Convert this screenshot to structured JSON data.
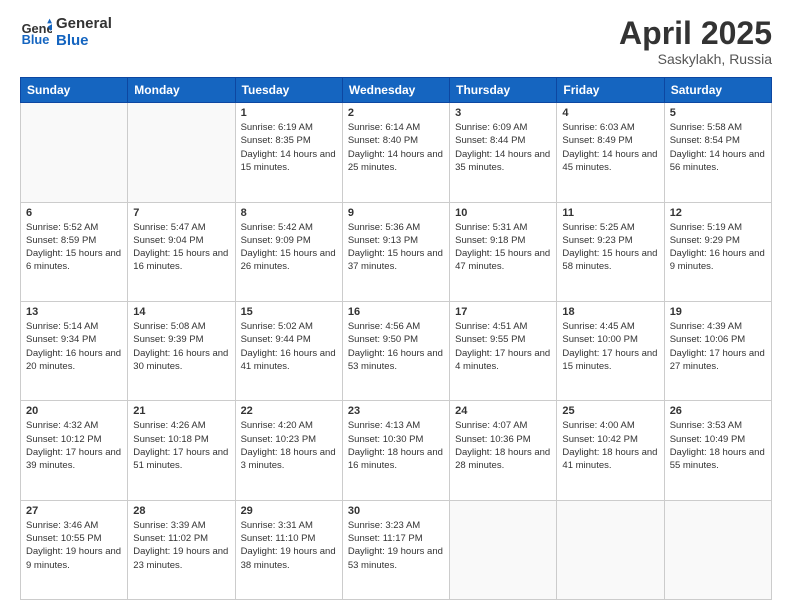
{
  "header": {
    "logo_line1": "General",
    "logo_line2": "Blue",
    "month": "April 2025",
    "location": "Saskylakh, Russia"
  },
  "weekdays": [
    "Sunday",
    "Monday",
    "Tuesday",
    "Wednesday",
    "Thursday",
    "Friday",
    "Saturday"
  ],
  "weeks": [
    [
      {
        "day": "",
        "content": ""
      },
      {
        "day": "",
        "content": ""
      },
      {
        "day": "1",
        "content": "Sunrise: 6:19 AM\nSunset: 8:35 PM\nDaylight: 14 hours and 15 minutes."
      },
      {
        "day": "2",
        "content": "Sunrise: 6:14 AM\nSunset: 8:40 PM\nDaylight: 14 hours and 25 minutes."
      },
      {
        "day": "3",
        "content": "Sunrise: 6:09 AM\nSunset: 8:44 PM\nDaylight: 14 hours and 35 minutes."
      },
      {
        "day": "4",
        "content": "Sunrise: 6:03 AM\nSunset: 8:49 PM\nDaylight: 14 hours and 45 minutes."
      },
      {
        "day": "5",
        "content": "Sunrise: 5:58 AM\nSunset: 8:54 PM\nDaylight: 14 hours and 56 minutes."
      }
    ],
    [
      {
        "day": "6",
        "content": "Sunrise: 5:52 AM\nSunset: 8:59 PM\nDaylight: 15 hours and 6 minutes."
      },
      {
        "day": "7",
        "content": "Sunrise: 5:47 AM\nSunset: 9:04 PM\nDaylight: 15 hours and 16 minutes."
      },
      {
        "day": "8",
        "content": "Sunrise: 5:42 AM\nSunset: 9:09 PM\nDaylight: 15 hours and 26 minutes."
      },
      {
        "day": "9",
        "content": "Sunrise: 5:36 AM\nSunset: 9:13 PM\nDaylight: 15 hours and 37 minutes."
      },
      {
        "day": "10",
        "content": "Sunrise: 5:31 AM\nSunset: 9:18 PM\nDaylight: 15 hours and 47 minutes."
      },
      {
        "day": "11",
        "content": "Sunrise: 5:25 AM\nSunset: 9:23 PM\nDaylight: 15 hours and 58 minutes."
      },
      {
        "day": "12",
        "content": "Sunrise: 5:19 AM\nSunset: 9:29 PM\nDaylight: 16 hours and 9 minutes."
      }
    ],
    [
      {
        "day": "13",
        "content": "Sunrise: 5:14 AM\nSunset: 9:34 PM\nDaylight: 16 hours and 20 minutes."
      },
      {
        "day": "14",
        "content": "Sunrise: 5:08 AM\nSunset: 9:39 PM\nDaylight: 16 hours and 30 minutes."
      },
      {
        "day": "15",
        "content": "Sunrise: 5:02 AM\nSunset: 9:44 PM\nDaylight: 16 hours and 41 minutes."
      },
      {
        "day": "16",
        "content": "Sunrise: 4:56 AM\nSunset: 9:50 PM\nDaylight: 16 hours and 53 minutes."
      },
      {
        "day": "17",
        "content": "Sunrise: 4:51 AM\nSunset: 9:55 PM\nDaylight: 17 hours and 4 minutes."
      },
      {
        "day": "18",
        "content": "Sunrise: 4:45 AM\nSunset: 10:00 PM\nDaylight: 17 hours and 15 minutes."
      },
      {
        "day": "19",
        "content": "Sunrise: 4:39 AM\nSunset: 10:06 PM\nDaylight: 17 hours and 27 minutes."
      }
    ],
    [
      {
        "day": "20",
        "content": "Sunrise: 4:32 AM\nSunset: 10:12 PM\nDaylight: 17 hours and 39 minutes."
      },
      {
        "day": "21",
        "content": "Sunrise: 4:26 AM\nSunset: 10:18 PM\nDaylight: 17 hours and 51 minutes."
      },
      {
        "day": "22",
        "content": "Sunrise: 4:20 AM\nSunset: 10:23 PM\nDaylight: 18 hours and 3 minutes."
      },
      {
        "day": "23",
        "content": "Sunrise: 4:13 AM\nSunset: 10:30 PM\nDaylight: 18 hours and 16 minutes."
      },
      {
        "day": "24",
        "content": "Sunrise: 4:07 AM\nSunset: 10:36 PM\nDaylight: 18 hours and 28 minutes."
      },
      {
        "day": "25",
        "content": "Sunrise: 4:00 AM\nSunset: 10:42 PM\nDaylight: 18 hours and 41 minutes."
      },
      {
        "day": "26",
        "content": "Sunrise: 3:53 AM\nSunset: 10:49 PM\nDaylight: 18 hours and 55 minutes."
      }
    ],
    [
      {
        "day": "27",
        "content": "Sunrise: 3:46 AM\nSunset: 10:55 PM\nDaylight: 19 hours and 9 minutes."
      },
      {
        "day": "28",
        "content": "Sunrise: 3:39 AM\nSunset: 11:02 PM\nDaylight: 19 hours and 23 minutes."
      },
      {
        "day": "29",
        "content": "Sunrise: 3:31 AM\nSunset: 11:10 PM\nDaylight: 19 hours and 38 minutes."
      },
      {
        "day": "30",
        "content": "Sunrise: 3:23 AM\nSunset: 11:17 PM\nDaylight: 19 hours and 53 minutes."
      },
      {
        "day": "",
        "content": ""
      },
      {
        "day": "",
        "content": ""
      },
      {
        "day": "",
        "content": ""
      }
    ]
  ]
}
